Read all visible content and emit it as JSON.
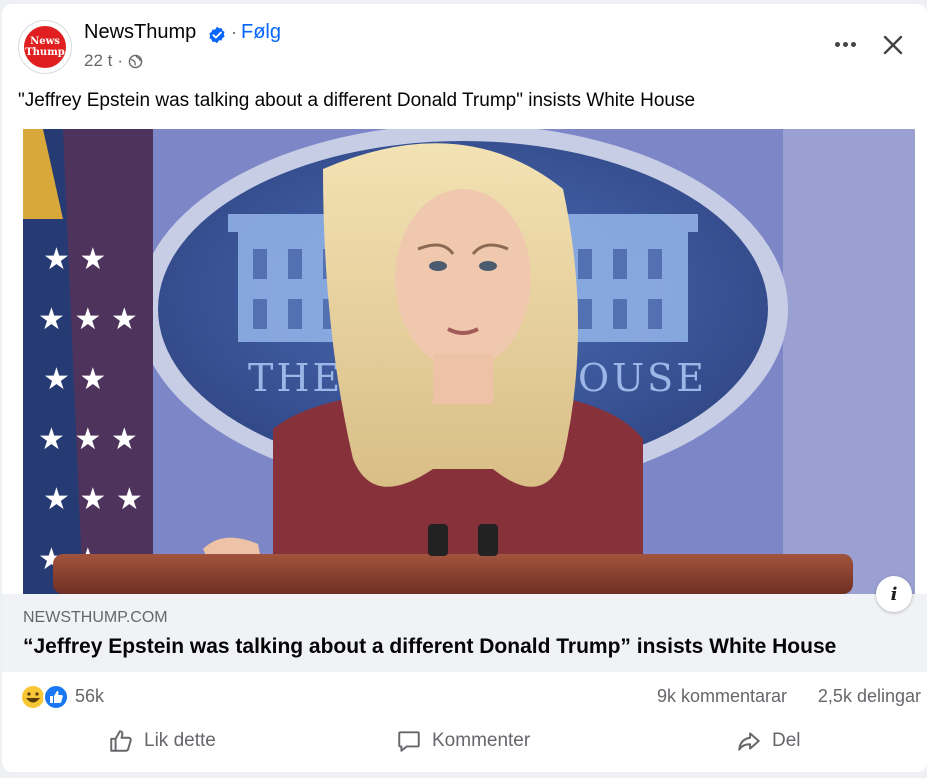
{
  "post": {
    "page_name": "NewsThump",
    "follow_label": "Følg",
    "time": "22 t",
    "caption": "\"Jeffrey Epstein was talking about a different Donald Trump\" insists White House",
    "avatar_text_line1": "News",
    "avatar_text_line2": "Thump"
  },
  "image": {
    "seal_text_left": "THE",
    "seal_text_right": "OUSE"
  },
  "link": {
    "domain": "NEWSTHUMP.COM",
    "headline": "“Jeffrey Epstein was talking about a different Donald Trump” insists White House",
    "info_label": "i"
  },
  "stats": {
    "reaction_count": "56k",
    "comments": "9k kommentarar",
    "shares": "2,5k delingar"
  },
  "actions": {
    "like": "Lik dette",
    "comment": "Kommenter",
    "share": "Del"
  },
  "colors": {
    "accent": "#0866ff",
    "text_secondary": "#65676b",
    "logo_red": "#e02020"
  }
}
